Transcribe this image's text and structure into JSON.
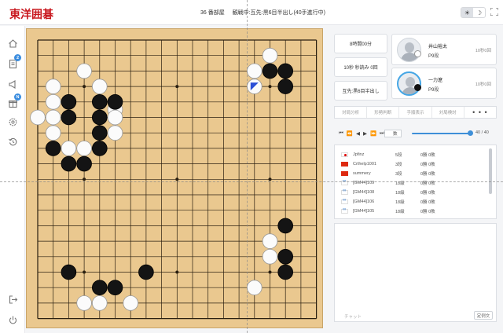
{
  "header": {
    "logo_text": "東洋囲碁",
    "room": "36 番部屋",
    "status": "観戦中:互先:黒6目半出し(40手進行中)"
  },
  "theme_toggle": {
    "light_icon": "sun-icon",
    "dark_icon": "moon-icon",
    "dark_glyph": "☽",
    "light_glyph": "☀"
  },
  "sidebar": {
    "items": [
      {
        "name": "home-icon"
      },
      {
        "name": "document-icon",
        "badge": "2"
      },
      {
        "name": "megaphone-icon"
      },
      {
        "name": "gift-icon",
        "badge": "N"
      },
      {
        "name": "settings-icon"
      },
      {
        "name": "history-icon"
      },
      {
        "name": "logout-icon"
      },
      {
        "name": "power-icon"
      }
    ]
  },
  "game": {
    "time_setting": "8時間00分",
    "byoyomi": "10秒 秒読み 0回",
    "rules": "互先:黒6目半出し",
    "players": [
      {
        "name": "井山裕太",
        "rank": "P9段",
        "time": "10秒0回",
        "color": "white"
      },
      {
        "name": "一力遼",
        "rank": "P9段",
        "time": "10秒0回",
        "color": "black"
      }
    ]
  },
  "tabs": [
    "対局分析",
    "形勢判断",
    "手順表示",
    "対局検討",
    "• • •"
  ],
  "playback": {
    "buttons": [
      "⏮",
      "⏪",
      "◀",
      "▶",
      "⏩",
      "⏭"
    ],
    "move_input": "数",
    "current": "40",
    "total": "40",
    "progress": 1.0
  },
  "viewers": [
    {
      "flag": "jp",
      "name": "Jpfinz",
      "rank": "5段",
      "stats": "0勝 0敗"
    },
    {
      "flag": "cn",
      "name": "Crthelp1001",
      "rank": "3段",
      "stats": "0勝 0敗"
    },
    {
      "flag": "cn",
      "name": "summery",
      "rank": "3段",
      "stats": "0勝 0敗"
    },
    {
      "flag": "ol",
      "name": "[GM44]109",
      "rank": "18級",
      "stats": "0勝 0敗"
    },
    {
      "flag": "ol",
      "name": "[GM44]108",
      "rank": "18級",
      "stats": "0勝 0敗"
    },
    {
      "flag": "ol",
      "name": "[GM44]106",
      "rank": "18級",
      "stats": "0勝 0敗"
    },
    {
      "flag": "ol",
      "name": "[GM44]105",
      "rank": "18級",
      "stats": "0勝 0敗"
    }
  ],
  "chat": {
    "placeholder": "チャット",
    "send_label": "定例文"
  },
  "board": {
    "size": 19,
    "last_move": [
      14,
      3
    ],
    "stones": {
      "black": [
        [
          2,
          4
        ],
        [
          4,
          4
        ],
        [
          4,
          5
        ],
        [
          4,
          6
        ],
        [
          4,
          7
        ],
        [
          2,
          5
        ],
        [
          2,
          8
        ],
        [
          3,
          8
        ],
        [
          1,
          7
        ],
        [
          5,
          4
        ],
        [
          15,
          2
        ],
        [
          16,
          2
        ],
        [
          16,
          3
        ],
        [
          16,
          12
        ],
        [
          16,
          14
        ],
        [
          16,
          15
        ],
        [
          2,
          15
        ],
        [
          4,
          16
        ],
        [
          5,
          16
        ],
        [
          7,
          15
        ]
      ],
      "white": [
        [
          3,
          2
        ],
        [
          1,
          3
        ],
        [
          4,
          3
        ],
        [
          1,
          4
        ],
        [
          5,
          4.5
        ],
        [
          0,
          5
        ],
        [
          1,
          5
        ],
        [
          5,
          5
        ],
        [
          5,
          6
        ],
        [
          1,
          6
        ],
        [
          2,
          7
        ],
        [
          3,
          7
        ],
        [
          14,
          2
        ],
        [
          15,
          1
        ],
        [
          14,
          3
        ],
        [
          15,
          13
        ],
        [
          15,
          14
        ],
        [
          14,
          16
        ],
        [
          3,
          17
        ],
        [
          4,
          17
        ],
        [
          6,
          17
        ]
      ]
    }
  }
}
